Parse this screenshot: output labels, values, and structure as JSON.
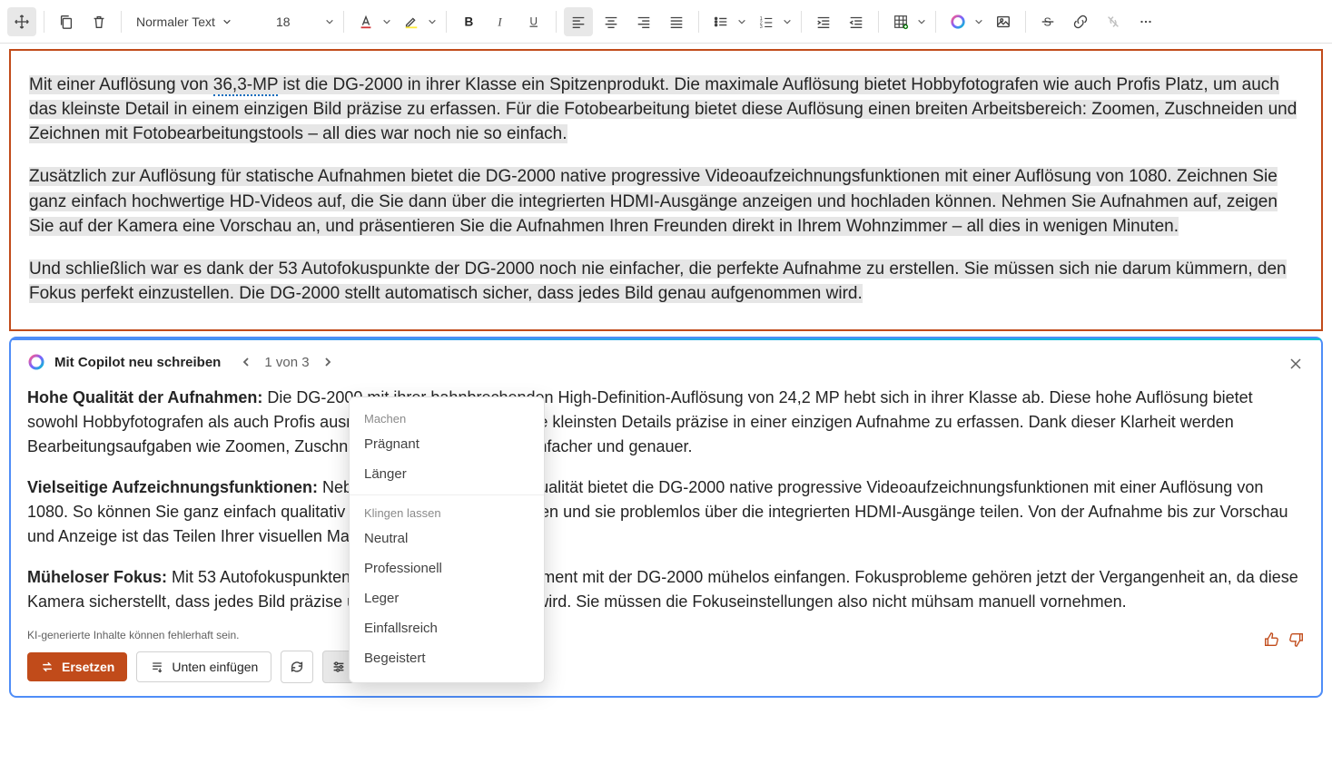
{
  "toolbar": {
    "text_style": "Normaler Text",
    "font_size": "18"
  },
  "document": {
    "p1_pre": "Mit einer Auflösung von ",
    "p1_mp": "36,3-MP",
    "p1_post": " ist die DG-2000 in ihrer Klasse ein Spitzenprodukt. Die maximale Auflösung bietet Hobbyfotografen wie auch Profis Platz, um auch das kleinste Detail in einem einzigen Bild präzise zu erfassen. Für die Fotobearbeitung bietet diese Auflösung einen breiten Arbeitsbereich: Zoomen, Zuschneiden und Zeichnen mit Fotobearbeitungstools – all dies war noch nie so einfach.",
    "p2": "Zusätzlich zur Auflösung für statische Aufnahmen bietet die DG-2000 native progressive Videoaufzeichnungsfunktionen mit einer Auflösung von 1080. Zeichnen Sie ganz einfach hochwertige HD-Videos auf, die Sie dann über die integrierten HDMI-Ausgänge anzeigen und hochladen können. Nehmen Sie Aufnahmen auf, zeigen Sie auf der Kamera eine Vorschau an, und präsentieren Sie die Aufnahmen Ihren Freunden direkt in Ihrem Wohnzimmer – all dies in wenigen Minuten.",
    "p3": "Und schließlich war es dank der 53 Autofokuspunkte der DG-2000 noch nie einfacher, die perfekte Aufnahme zu erstellen. Sie müssen sich nie darum kümmern, den Fokus perfekt einzustellen. Die DG-2000 stellt automatisch sicher, dass jedes Bild genau aufgenommen wird."
  },
  "copilot": {
    "title": "Mit Copilot neu schreiben",
    "pager": "1 von 3",
    "body": {
      "h1": "Hohe Qualität der Aufnahmen: ",
      "t1": "Die DG-2000 mit ihrer bahnbrechenden High-Definition-Auflösung von 24,2 MP hebt sich in ihrer Klasse ab. Diese hohe Auflösung bietet sowohl Hobbyfotografen als auch Profis ausreichend Platz, um auch die kleinsten Details präzise in einer einzigen Aufnahme zu erfassen. Dank dieser Klarheit werden Bearbeitungsaufgaben wie Zoomen, Zuschneiden und Retuschieren einfacher und genauer.",
      "h2": "Vielseitige Aufzeichnungsfunktionen: ",
      "t2": "Neben der erstklassigen Bildqualität bietet die DG-2000 native progressive Videoaufzeichnungsfunktionen mit einer Auflösung von 1080. So können Sie ganz einfach qualitativ hochwertige Videos erstellen und sie problemlos über die integrierten HDMI-Ausgänge teilen. Von der Aufnahme bis zur Vorschau und Anzeige ist das Teilen Ihrer visuellen Materialien jetzt viel einfacher.",
      "h3": "Müheloser Fokus: ",
      "t3": "Mit 53 Autofokuspunkten lässt sich der perfekte Moment mit der DG-2000 mühelos einfangen. Fokusprobleme gehören jetzt der Vergangenheit an, da diese Kamera sicherstellt, dass jedes Bild präzise und scharf aufgenommen wird. Sie müssen die Fokuseinstellungen also nicht mühsam manuell vornehmen."
    },
    "disclaimer": "KI-generierte Inhalte können fehlerhaft sein.",
    "actions": {
      "replace": "Ersetzen",
      "insert_below": "Unten einfügen"
    }
  },
  "menu": {
    "group1": "Machen",
    "pragnant": "Prägnant",
    "langer": "Länger",
    "group2": "Klingen lassen",
    "neutral": "Neutral",
    "professionell": "Professionell",
    "leger": "Leger",
    "einfallsreich": "Einfallsreich",
    "begeistert": "Begeistert"
  }
}
